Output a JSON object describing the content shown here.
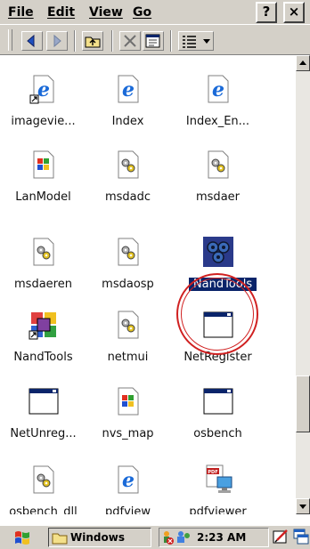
{
  "menu": {
    "items": [
      {
        "label": "File"
      },
      {
        "label": "Edit"
      },
      {
        "label": "View"
      },
      {
        "label": "Go"
      }
    ],
    "help_label": "?",
    "close_label": "×"
  },
  "toolbar": {
    "buttons": [
      "back-icon",
      "forward-icon",
      "up-folder-icon",
      "delete-icon",
      "properties-icon",
      "view-menu-icon"
    ]
  },
  "files": [
    {
      "name": "imagevie...",
      "icon": "ie-shortcut-icon"
    },
    {
      "name": "Index",
      "icon": "ie-page-icon"
    },
    {
      "name": "Index_En...",
      "icon": "ie-page-icon"
    },
    {
      "name": "LanModel",
      "icon": "windows-app-icon"
    },
    {
      "name": "msdadc",
      "icon": "gear-dll-icon"
    },
    {
      "name": "msdaer",
      "icon": "gear-dll-icon"
    },
    {
      "name": "msdaeren",
      "icon": "gear-dll-icon"
    },
    {
      "name": "msdaosp",
      "icon": "gear-dll-icon"
    },
    {
      "name": "NandTools",
      "icon": "nandtools-app-icon",
      "selected": true
    },
    {
      "name": "NandTools",
      "icon": "nandtools-shortcut-icon"
    },
    {
      "name": "netmui",
      "icon": "gear-dll-icon"
    },
    {
      "name": "NetRegister",
      "icon": "window-app-icon"
    },
    {
      "name": "NetUnreg...",
      "icon": "window-app-icon"
    },
    {
      "name": "nvs_map",
      "icon": "windows-app-icon"
    },
    {
      "name": "osbench",
      "icon": "window-app-icon"
    },
    {
      "name": "osbench_dll",
      "icon": "gear-dll-icon"
    },
    {
      "name": "pdfview",
      "icon": "ie-page-icon"
    },
    {
      "name": "pdfviewer",
      "icon": "pdf-app-icon"
    }
  ],
  "taskbar": {
    "start_icon": "windows-flag-icon",
    "active_window": "Windows",
    "clock": "2:23 AM"
  },
  "colors": {
    "chrome": "#d4d0c8",
    "selection": "#0a246a",
    "annotation_circle": "#d02020"
  }
}
